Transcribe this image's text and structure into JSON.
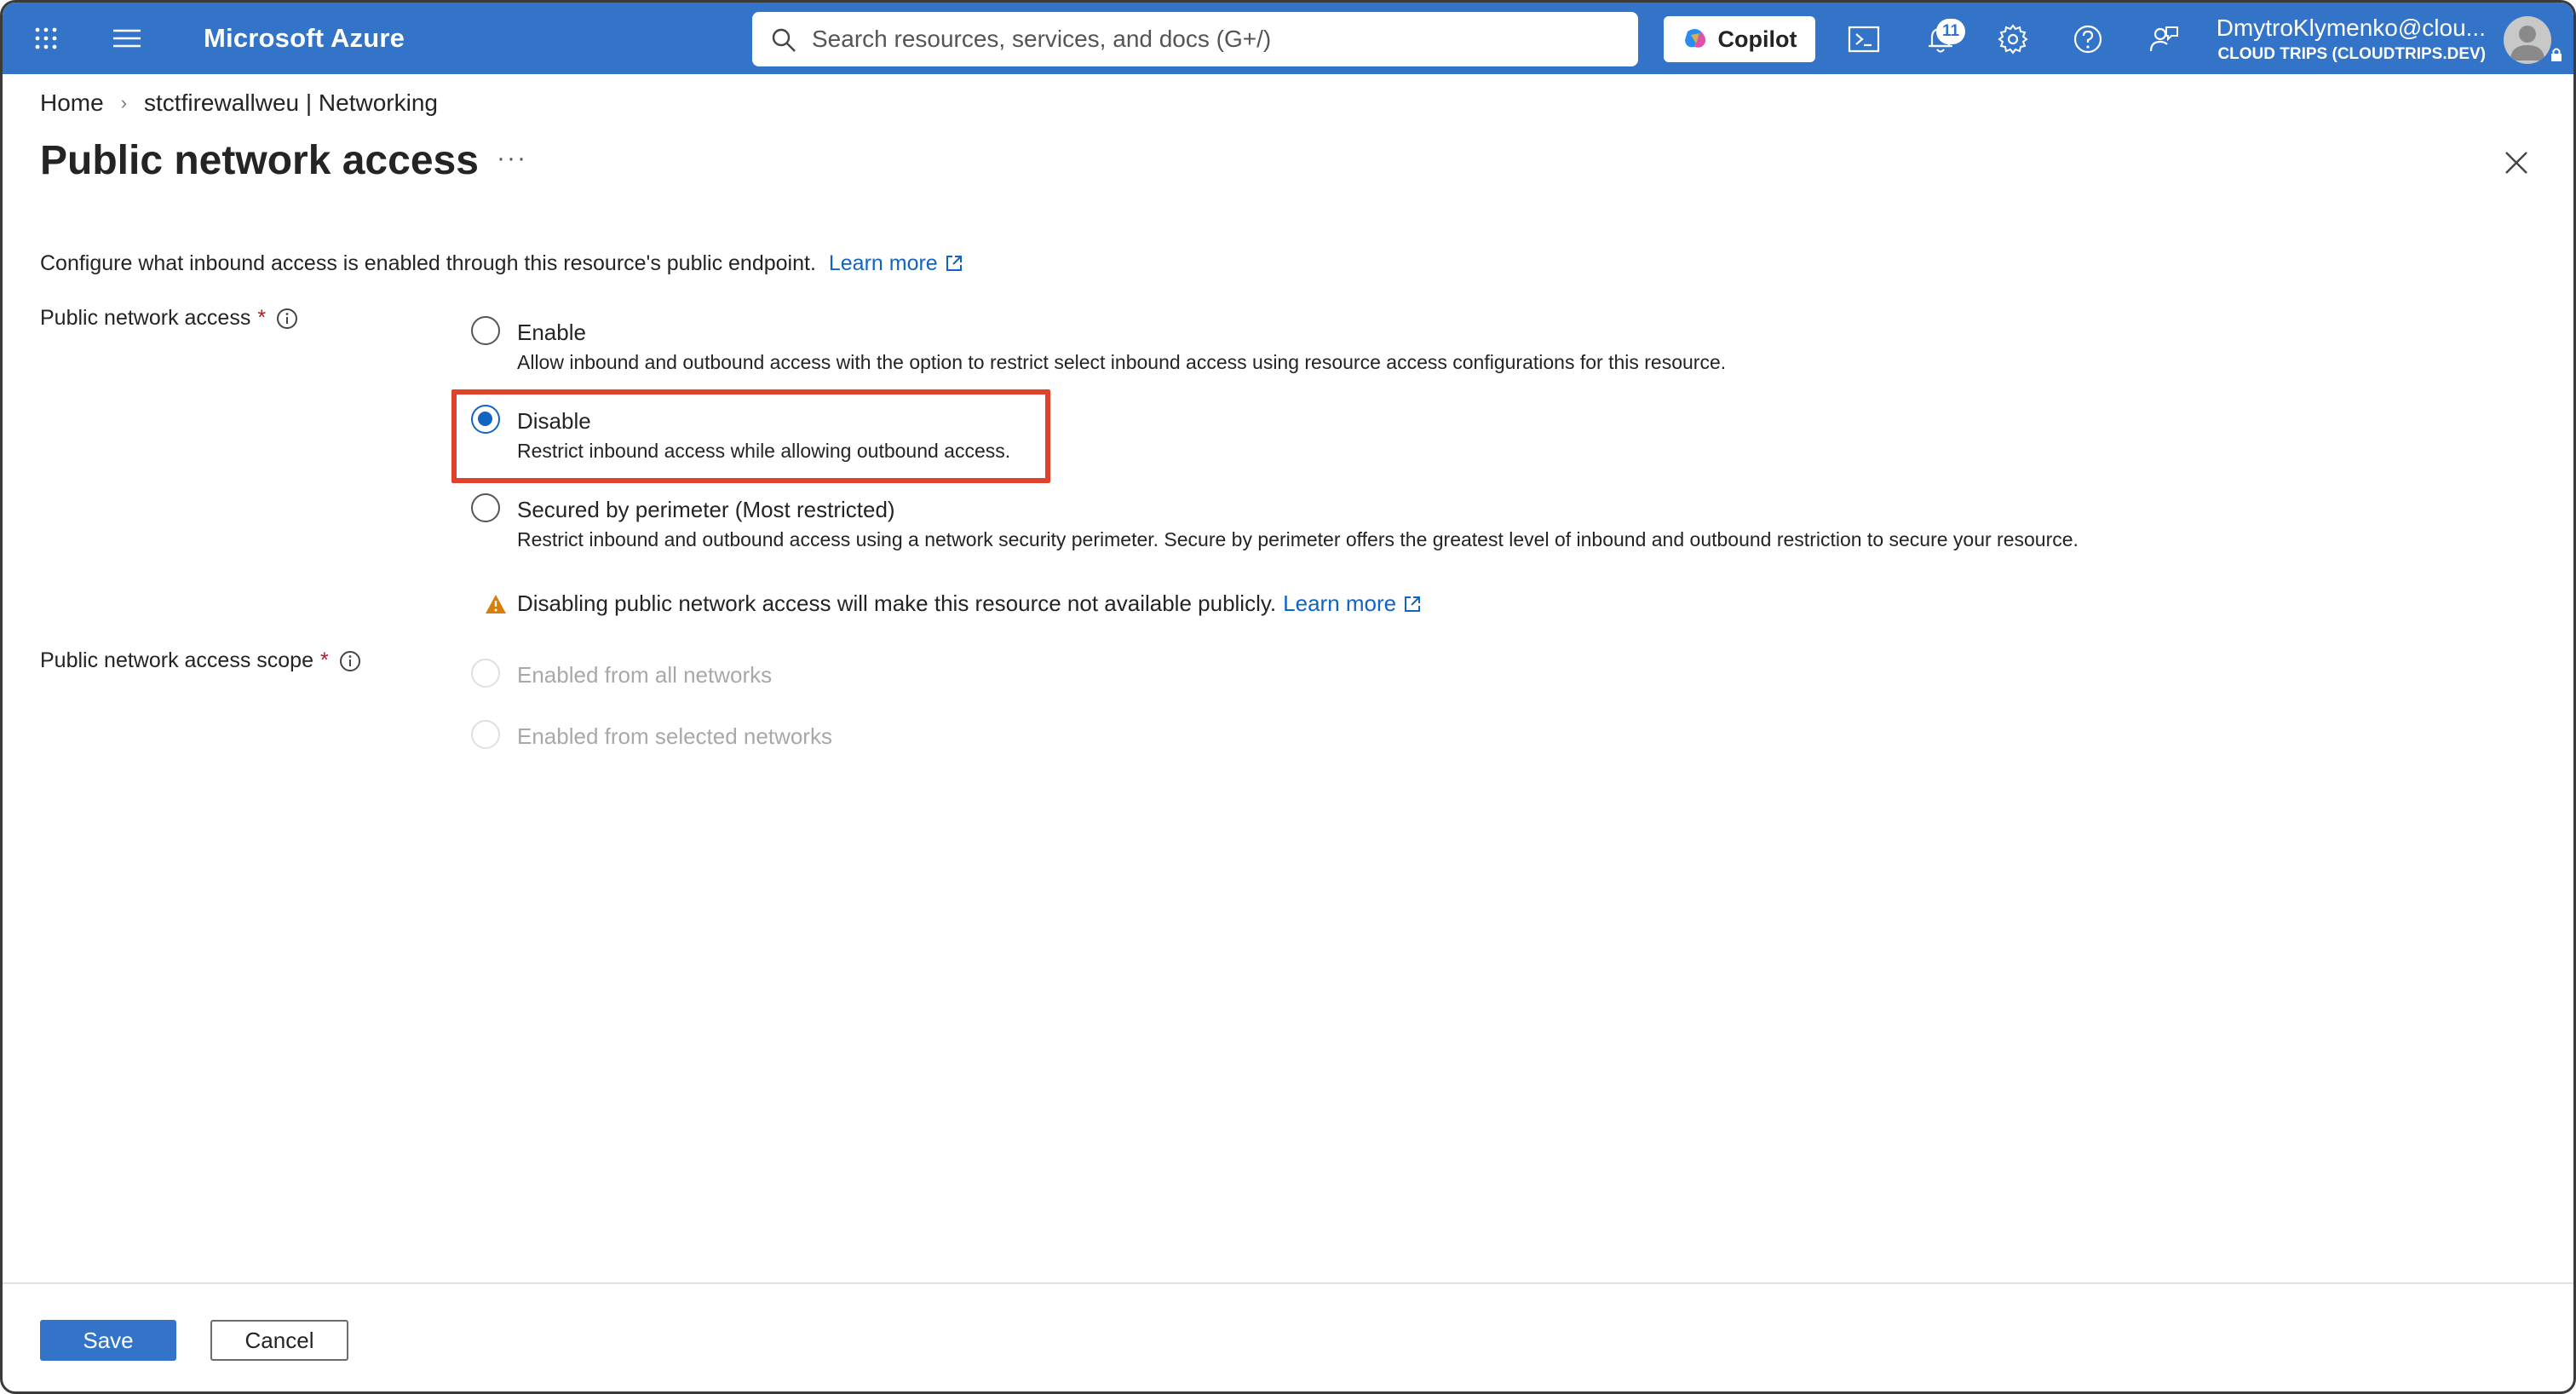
{
  "topbar": {
    "brand": "Microsoft Azure",
    "search_placeholder": "Search resources, services, and docs (G+/)",
    "copilot_label": "Copilot",
    "notification_count": "11",
    "user": "DmytroKlymenko@clou...",
    "tenant": "CLOUD TRIPS (CLOUDTRIPS.DEV)"
  },
  "breadcrumb": {
    "home": "Home",
    "resource": "stctfirewallweu | Networking"
  },
  "page": {
    "title": "Public network access",
    "more": "···",
    "description": "Configure what inbound access is enabled through this resource's public endpoint.",
    "learn_more": "Learn more"
  },
  "public_network_access": {
    "label": "Public network access",
    "required_mark": "*",
    "options": [
      {
        "label": "Enable",
        "description": "Allow inbound and outbound access with the option to restrict select inbound access using resource access configurations for this resource.",
        "selected": false
      },
      {
        "label": "Disable",
        "description": "Restrict inbound access while allowing outbound access.",
        "selected": true
      },
      {
        "label": "Secured by perimeter (Most restricted)",
        "description": "Restrict inbound and outbound access using a network security perimeter. Secure by perimeter offers the greatest level of inbound and outbound restriction to secure your resource.",
        "selected": false
      }
    ],
    "warning": "Disabling public network access will make this resource not available publicly.",
    "warning_learn_more": "Learn more"
  },
  "scope": {
    "label": "Public network access scope",
    "required_mark": "*",
    "options": [
      {
        "label": "Enabled from all networks",
        "disabled": true
      },
      {
        "label": "Enabled from selected networks",
        "disabled": true
      }
    ]
  },
  "footer": {
    "save_label": "Save",
    "cancel_label": "Cancel"
  },
  "colors": {
    "topbar": "#3374c9",
    "link": "#1064c4",
    "highlight": "#e0412b",
    "warning": "#d67f0a"
  }
}
